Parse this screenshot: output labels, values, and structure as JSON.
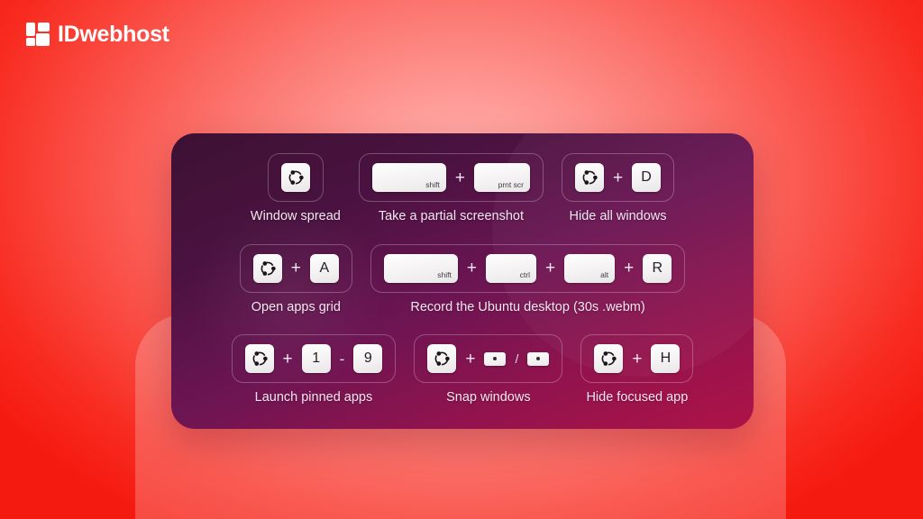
{
  "brand": {
    "name": "IDwebhost",
    "mark_icon": "idwebhost-logo-icon",
    "color": "#ffffff"
  },
  "theme": {
    "background_outer": "#f51a10",
    "background_center": "#ffb3b0",
    "card_gradient_start": "#3d1133",
    "card_gradient_end": "#ae1347",
    "key_face": "#ffffff",
    "caption_color": "#f4e6f0"
  },
  "card": {
    "title": "",
    "rows": [
      {
        "shortcuts": [
          {
            "id": "window-spread",
            "caption": "Window spread",
            "keys": [
              {
                "type": "icon",
                "icon": "ubuntu-logo-icon",
                "label": ""
              }
            ]
          },
          {
            "id": "partial-screenshot",
            "caption": "Take a partial screenshot",
            "keys": [
              {
                "type": "modifier",
                "label": "shift",
                "width": "w-shift"
              },
              {
                "type": "sep",
                "label": "+"
              },
              {
                "type": "modifier",
                "label": "prnt scr",
                "width": "w-prnt"
              }
            ]
          },
          {
            "id": "hide-all-windows",
            "caption": "Hide all windows",
            "keys": [
              {
                "type": "icon",
                "icon": "ubuntu-logo-icon",
                "label": ""
              },
              {
                "type": "sep",
                "label": "+"
              },
              {
                "type": "letter",
                "label": "D"
              }
            ]
          }
        ]
      },
      {
        "shortcuts": [
          {
            "id": "open-apps-grid",
            "caption": "Open apps grid",
            "keys": [
              {
                "type": "icon",
                "icon": "ubuntu-logo-icon",
                "label": ""
              },
              {
                "type": "sep",
                "label": "+"
              },
              {
                "type": "letter",
                "label": "A"
              }
            ]
          },
          {
            "id": "record-desktop",
            "caption": "Record the Ubuntu desktop (30s .webm)",
            "keys": [
              {
                "type": "modifier",
                "label": "shift",
                "width": "w-shift"
              },
              {
                "type": "sep",
                "label": "+"
              },
              {
                "type": "modifier",
                "label": "ctrl",
                "width": "w-ctrl"
              },
              {
                "type": "sep",
                "label": "+"
              },
              {
                "type": "modifier",
                "label": "alt",
                "width": "w-alt"
              },
              {
                "type": "sep",
                "label": "+"
              },
              {
                "type": "letter",
                "label": "R"
              }
            ]
          }
        ]
      },
      {
        "shortcuts": [
          {
            "id": "launch-pinned-apps",
            "caption": "Launch pinned apps",
            "keys": [
              {
                "type": "icon",
                "icon": "ubuntu-logo-icon",
                "label": ""
              },
              {
                "type": "sep",
                "label": "+"
              },
              {
                "type": "letter",
                "label": "1"
              },
              {
                "type": "range",
                "label": "-"
              },
              {
                "type": "letter",
                "label": "9"
              }
            ]
          },
          {
            "id": "snap-windows",
            "caption": "Snap windows",
            "keys": [
              {
                "type": "icon",
                "icon": "ubuntu-logo-icon",
                "label": ""
              },
              {
                "type": "sep",
                "label": "+"
              },
              {
                "type": "arrow",
                "icon": "arrow-left-key-icon",
                "label": ""
              },
              {
                "type": "slash",
                "label": "/"
              },
              {
                "type": "arrow",
                "icon": "arrow-right-key-icon",
                "label": ""
              }
            ]
          },
          {
            "id": "hide-focused-app",
            "caption": "Hide focused app",
            "keys": [
              {
                "type": "icon",
                "icon": "ubuntu-logo-icon",
                "label": ""
              },
              {
                "type": "sep",
                "label": "+"
              },
              {
                "type": "letter",
                "label": "H"
              }
            ]
          }
        ]
      }
    ]
  }
}
